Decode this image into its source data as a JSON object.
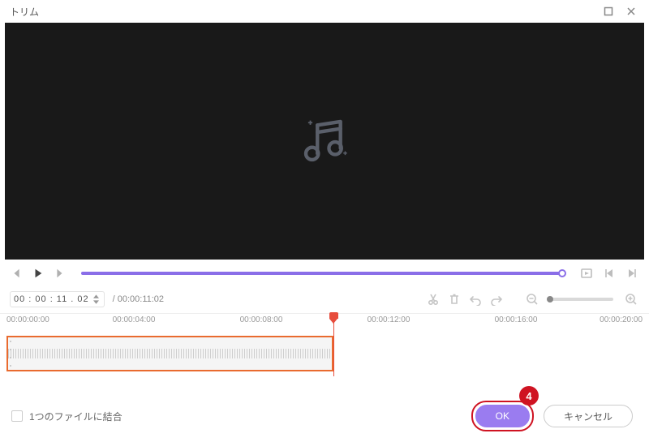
{
  "window": {
    "title": "トリム"
  },
  "playback": {
    "current_time": "00 : 00 : 11 . 02",
    "total_time": "/ 00:00:11:02"
  },
  "timeline": {
    "ticks": [
      "00:00:00:00",
      "00:00:04:00",
      "00:00:08:00",
      "00:00:12:00",
      "00:00:16:00",
      "00:00:20:00"
    ]
  },
  "footer": {
    "merge_label": "1つのファイルに結合",
    "ok_label": "OK",
    "cancel_label": "キャンセル",
    "callout_number": "4"
  }
}
